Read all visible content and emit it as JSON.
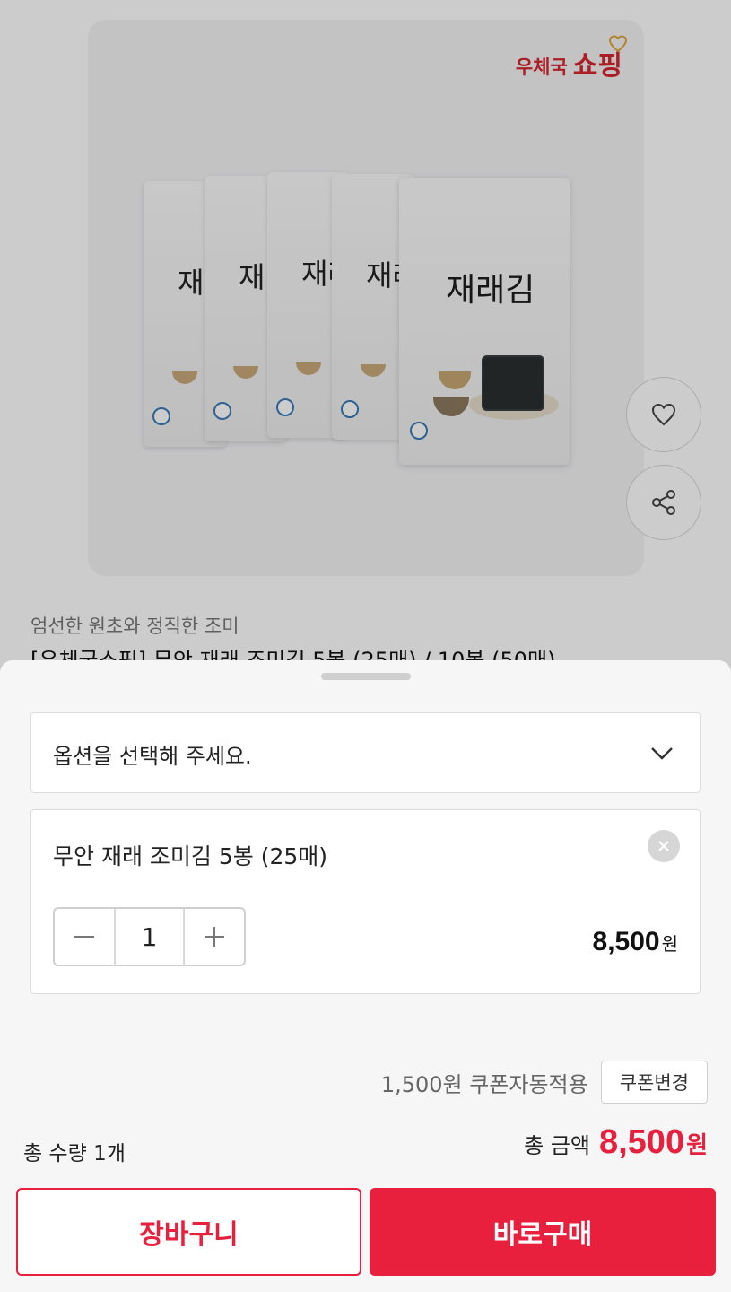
{
  "brand": {
    "small": "우체국",
    "big": "쇼핑"
  },
  "product": {
    "pack_title": "재래김",
    "subtitle": "엄선한 원초와 정직한 조미",
    "title": "[우체국쇼핑] 무안 재래 조미김 5봉 (25매) / 10봉 (50매)"
  },
  "actions": {
    "favorite_icon": "heart-icon",
    "share_icon": "share-icon"
  },
  "option": {
    "placeholder": "옵션을 선택해 주세요.",
    "icon": "chevron-down-icon"
  },
  "selected_item": {
    "name": "무안 재래 조미김 5봉 (25매)",
    "quantity": "1",
    "price": "8,500",
    "price_unit": "원"
  },
  "coupon": {
    "text": "1,500원 쿠폰자동적용",
    "button": "쿠폰변경"
  },
  "summary": {
    "total_qty": "총 수량 1개",
    "total_label": "총 금액",
    "total_value": "8,500",
    "total_unit": "원"
  },
  "buttons": {
    "cart": "장바구니",
    "buy": "바로구매"
  },
  "colors": {
    "accent": "#e8203d",
    "brand": "#d8262f"
  }
}
